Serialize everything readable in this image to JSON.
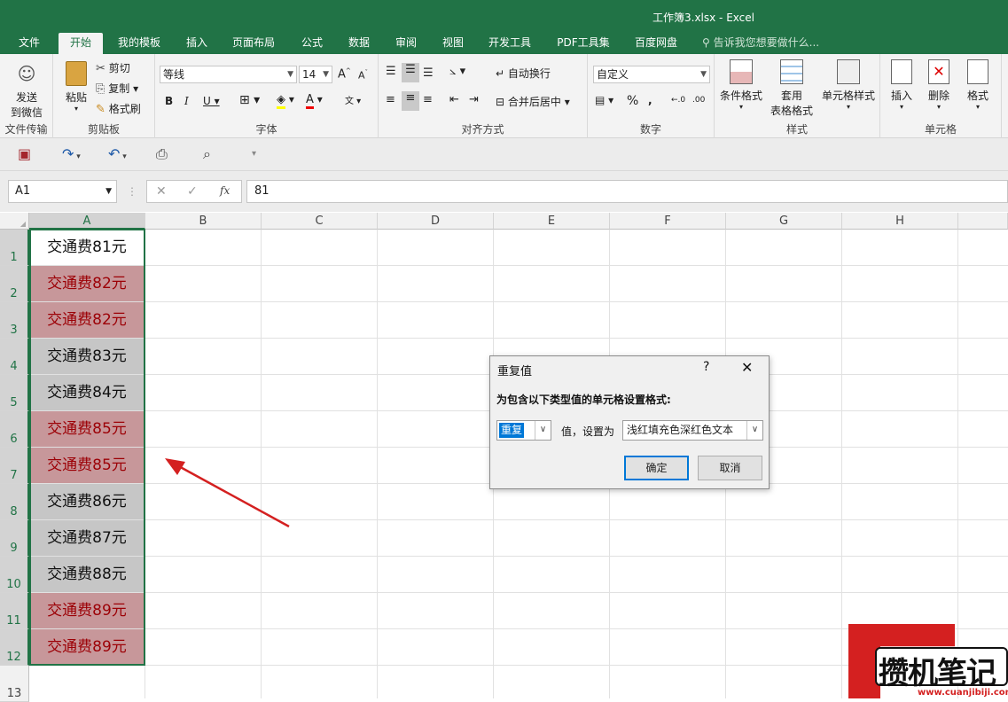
{
  "window": {
    "title": "工作簿3.xlsx - Excel"
  },
  "tabs": [
    "文件",
    "开始",
    "我的模板",
    "插入",
    "页面布局",
    "公式",
    "数据",
    "审阅",
    "视图",
    "开发工具",
    "PDF工具集",
    "百度网盘"
  ],
  "tellme": "告诉我您想要做什么...",
  "ribbon": {
    "send": {
      "label1": "发送",
      "label2": "到微信",
      "group": "文件传输"
    },
    "clipboard": {
      "paste": "粘贴",
      "cut": "剪切",
      "copy": "复制",
      "painter": "格式刷",
      "group": "剪贴板"
    },
    "font": {
      "name": "等线",
      "size": "14",
      "group": "字体"
    },
    "align": {
      "wrap": "自动换行",
      "merge": "合并后居中",
      "group": "对齐方式"
    },
    "number": {
      "format": "自定义",
      "group": "数字"
    },
    "styles": {
      "cond": "条件格式",
      "table1": "套用",
      "table2": "表格格式",
      "cellstyle": "单元格样式",
      "group": "样式"
    },
    "cells": {
      "insert": "插入",
      "delete": "删除",
      "format": "格式",
      "group": "单元格"
    }
  },
  "formula_bar": {
    "name_box": "A1",
    "value": "81"
  },
  "columns": [
    "A",
    "B",
    "C",
    "D",
    "E",
    "F",
    "G",
    "H"
  ],
  "rows": [
    "1",
    "2",
    "3",
    "4",
    "5",
    "6",
    "7",
    "8",
    "9",
    "10",
    "11",
    "12",
    "13"
  ],
  "cells": [
    {
      "text": "交通费81元",
      "style": "first"
    },
    {
      "text": "交通费82元",
      "style": "dup"
    },
    {
      "text": "交通费82元",
      "style": "dup"
    },
    {
      "text": "交通费83元",
      "style": "norm"
    },
    {
      "text": "交通费84元",
      "style": "norm"
    },
    {
      "text": "交通费85元",
      "style": "dup"
    },
    {
      "text": "交通费85元",
      "style": "dup"
    },
    {
      "text": "交通费86元",
      "style": "norm"
    },
    {
      "text": "交通费87元",
      "style": "norm"
    },
    {
      "text": "交通费88元",
      "style": "norm"
    },
    {
      "text": "交通费89元",
      "style": "dup"
    },
    {
      "text": "交通费89元",
      "style": "dup"
    }
  ],
  "dialog": {
    "title": "重复值",
    "help": "?",
    "prompt": "为包含以下类型值的单元格设置格式:",
    "type_value": "重复",
    "label": "值，设置为",
    "format_value": "浅红填充色深红色文本",
    "ok": "确定",
    "cancel": "取消"
  },
  "watermark": {
    "text": "攒机笔记",
    "url": "www.cuanjibiji.com"
  },
  "colors": {
    "accent": "#217346",
    "dup_fill": "#c7979a",
    "dup_text": "#9c0006",
    "arrow": "#d42020"
  }
}
